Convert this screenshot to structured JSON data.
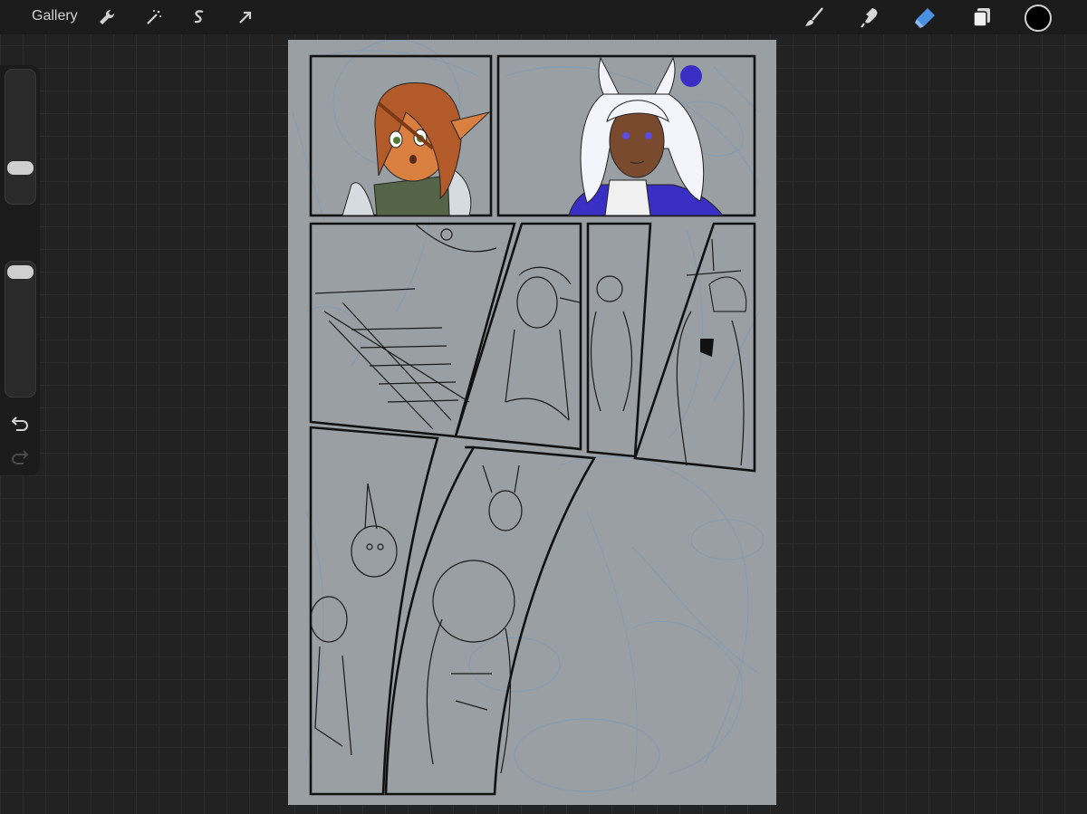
{
  "toolbar": {
    "gallery_label": "Gallery",
    "left_tools": [
      {
        "icon": "wrench-icon"
      },
      {
        "icon": "magic-wand-icon"
      },
      {
        "icon": "selection-icon"
      },
      {
        "icon": "transform-arrow-icon"
      }
    ],
    "right_tools": [
      {
        "icon": "brush-icon"
      },
      {
        "icon": "smudge-icon"
      },
      {
        "icon": "eraser-icon",
        "active": true
      },
      {
        "icon": "layers-icon"
      }
    ],
    "current_color": "#000000",
    "active_tool_color": "#4a90e2"
  },
  "sidebar": {
    "brush_size_slider": {
      "icon": "brush-size-slider"
    },
    "modify_button": {
      "icon": "square-icon"
    },
    "opacity_slider": {
      "icon": "opacity-slider"
    },
    "undo": {
      "icon": "undo-icon"
    },
    "redo": {
      "icon": "redo-icon",
      "enabled": false
    }
  },
  "canvas": {
    "background": "#999fa2",
    "panel_count": 7,
    "colors": {
      "sketch": "#7f9bb8",
      "ink": "#1a1a1a",
      "skin_elf": "#d98040",
      "hair_elf": "#b35a2a",
      "skin_bunny": "#7a4a2e",
      "hair_bunny": "#f4f4fb",
      "robe": "#3a2fc4",
      "shirt": "#556346"
    }
  }
}
